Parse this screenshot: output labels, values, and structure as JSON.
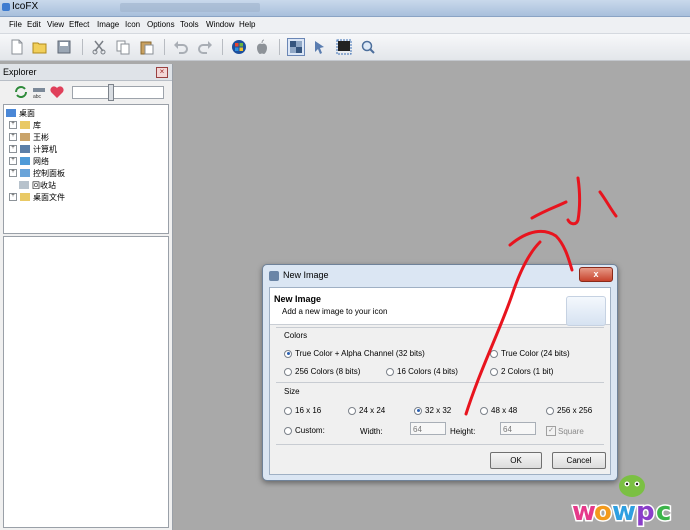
{
  "window": {
    "title": "IcoFX"
  },
  "menu": [
    "File",
    "Edit",
    "View",
    "Effect",
    "Image",
    "Icon",
    "Options",
    "Tools",
    "Window",
    "Help"
  ],
  "toolbar": {
    "icons": [
      "new-file-icon",
      "open-folder-icon",
      "save-icon",
      "cut-icon",
      "copy-icon",
      "paste-icon",
      "undo-icon",
      "redo-icon",
      "windows-logo-icon",
      "apple-logo-icon",
      "icon-mode-icon",
      "cursor-mode-icon",
      "capture-icon",
      "zoom-icon"
    ]
  },
  "explorer": {
    "title": "Explorer",
    "close": "×",
    "tree": {
      "root": "桌面",
      "items": [
        "库",
        "王彬",
        "计算机",
        "网络",
        "控制面板",
        "回收站",
        "桌面文件"
      ]
    }
  },
  "dialog": {
    "title": "New Image",
    "close": "x",
    "heading": "New Image",
    "subheading": "Add a new image to your icon",
    "colors": {
      "label": "Colors",
      "options": [
        "True Color + Alpha Channel (32 bits)",
        "True Color (24 bits)",
        "256 Colors (8 bits)",
        "16 Colors (4 bits)",
        "2 Colors (1 bit)"
      ],
      "selected": "True Color + Alpha Channel (32 bits)"
    },
    "size": {
      "label": "Size",
      "options": [
        "16 x 16",
        "24 x 24",
        "32 x 32",
        "48 x 48",
        "256 x 256",
        "Custom:"
      ],
      "selected": "32 x 32",
      "width_label": "Width:",
      "width_value": "64",
      "height_label": "Height:",
      "height_value": "64",
      "square_label": "Square",
      "square_checked": true
    },
    "ok": "OK",
    "cancel": "Cancel"
  },
  "annotation": {
    "handwritten": "小",
    "color": "#e8141e"
  },
  "watermark": "wowpc"
}
